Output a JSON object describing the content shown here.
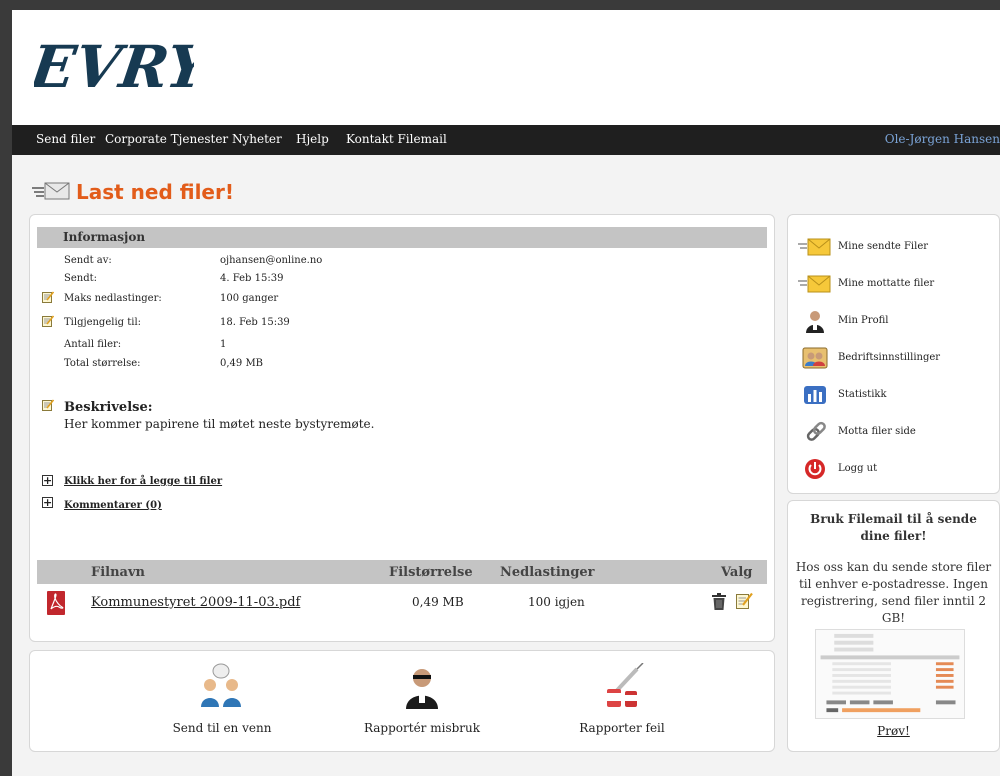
{
  "brand": {
    "logo_text": "EVRY"
  },
  "nav": {
    "items": [
      "Send filer",
      "Corporate Tjenester",
      "Nyheter",
      "Hjelp",
      "Kontakt Filemail"
    ],
    "user": "Ole-Jørgen Hansen"
  },
  "page": {
    "title": "Last ned filer!"
  },
  "info": {
    "header": "Informasjon",
    "rows": [
      {
        "label": "Sendt av:",
        "value": "ojhansen@online.no",
        "editable": false
      },
      {
        "label": "Sendt:",
        "value": "4. Feb 15:39",
        "editable": false
      },
      {
        "label": "Maks nedlastinger:",
        "value": "100 ganger",
        "editable": true
      },
      {
        "label": "Tilgjengelig til:",
        "value": "18. Feb 15:39",
        "editable": true
      },
      {
        "label": "Antall filer:",
        "value": "1",
        "editable": false
      },
      {
        "label": "Total størrelse:",
        "value": "0,49 MB",
        "editable": false
      }
    ],
    "description_title": "Beskrivelse:",
    "description_text": "Her kommer papirene til møtet neste bystyremøte.",
    "add_files_link": "Klikk her for å legge til filer",
    "comments_link": "Kommentarer (0)"
  },
  "files": {
    "columns": [
      "Filnavn",
      "Filstørrelse",
      "Nedlastinger",
      "Valg"
    ],
    "rows": [
      {
        "name": "Kommunestyret 2009-11-03.pdf",
        "size": "0,49 MB",
        "downloads": "100 igjen"
      }
    ]
  },
  "bottom_actions": [
    "Send til en venn",
    "Rapportér misbruk",
    "Rapporter feil"
  ],
  "sidebar": {
    "items": [
      {
        "label": "Mine sendte Filer",
        "icon": "envelope-send-icon"
      },
      {
        "label": "Mine mottatte filer",
        "icon": "envelope-receive-icon"
      },
      {
        "label": "Min Profil",
        "icon": "user-profile-icon"
      },
      {
        "label": "Bedriftsinnstillinger",
        "icon": "company-settings-icon"
      },
      {
        "label": "Statistikk",
        "icon": "statistics-icon"
      },
      {
        "label": "Motta filer side",
        "icon": "chain-link-icon"
      },
      {
        "label": "Logg ut",
        "icon": "power-icon"
      }
    ]
  },
  "promo": {
    "title": "Bruk Filemail til å sende dine filer!",
    "text": "Hos oss kan du sende store filer til enhver e-postadresse. Ingen registrering, send filer inntil 2 GB!",
    "link": "Prøv!"
  },
  "colors": {
    "accent": "#e25c1a",
    "navbar": "#1f1f1f",
    "user_link": "#7aa3d6",
    "bar": "#c4c4c4"
  }
}
